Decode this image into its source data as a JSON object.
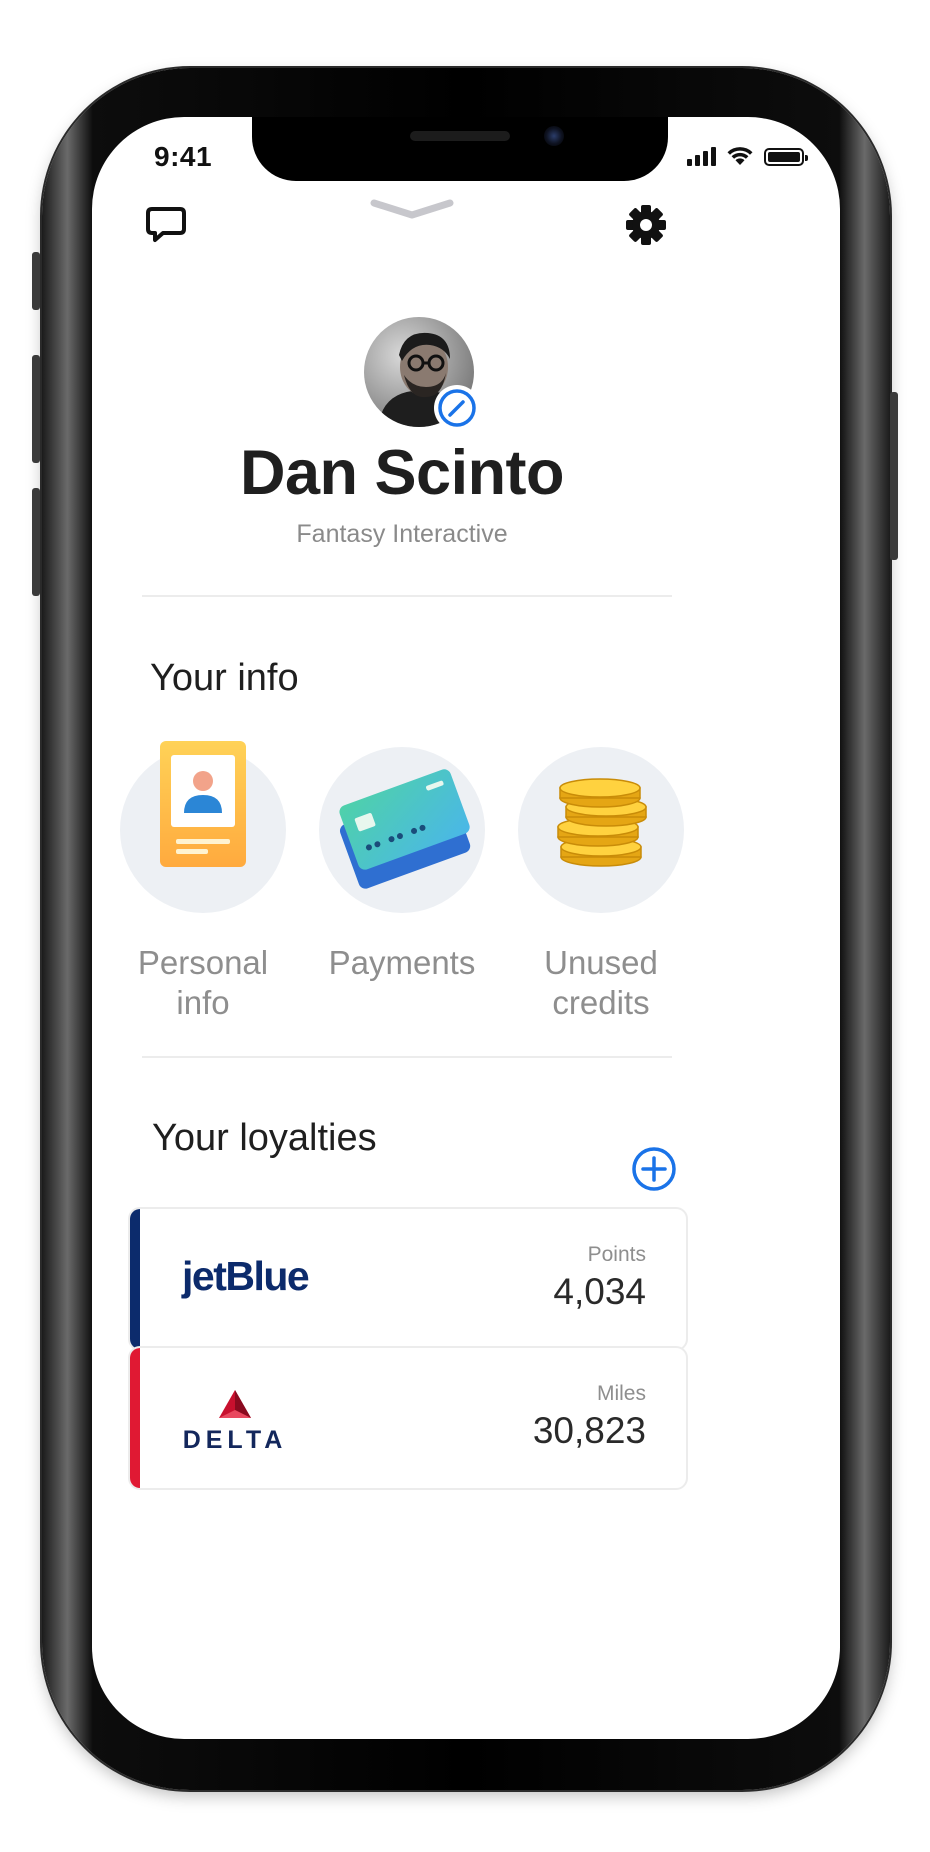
{
  "status_bar": {
    "time": "9:41"
  },
  "profile": {
    "name": "Dan Scinto",
    "company": "Fantasy Interactive"
  },
  "your_info": {
    "title": "Your info",
    "items": [
      {
        "label": "Personal info",
        "icon": "id-card-icon"
      },
      {
        "label": "Payments",
        "icon": "credit-card-icon"
      },
      {
        "label": "Unused credits",
        "icon": "coins-icon"
      }
    ]
  },
  "loyalties": {
    "title": "Your loyalties",
    "cards": [
      {
        "brand": "jetBlue",
        "metric_label": "Points",
        "metric_value": "4,034",
        "accent": "#0c2b6c"
      },
      {
        "brand": "DELTA",
        "metric_label": "Miles",
        "metric_value": "30,823",
        "accent": "#e01933"
      }
    ]
  },
  "colors": {
    "accent_blue": "#1a73e8",
    "divider": "#ececec",
    "circle_bg": "#edf0f4"
  }
}
